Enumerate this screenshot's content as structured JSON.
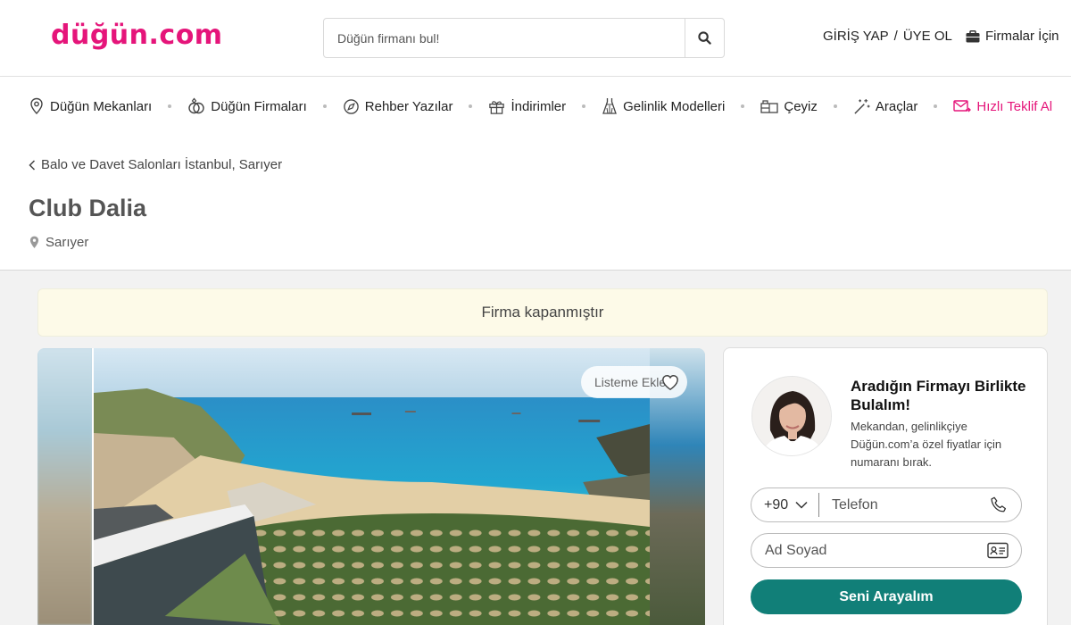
{
  "brand": {
    "logo_text": "düğün.com",
    "accent": "#e5157a",
    "cta_color": "#117f78"
  },
  "header": {
    "search_placeholder": "Düğün firmanı bul!",
    "search_icon": "search-icon",
    "login": "GİRİŞ YAP",
    "separator": "/",
    "register": "ÜYE OL",
    "for_business": "Firmalar İçin"
  },
  "nav": {
    "items": [
      {
        "label": "Düğün Mekanları",
        "icon": "location-pin-icon"
      },
      {
        "label": "Düğün Firmaları",
        "icon": "rings-icon"
      },
      {
        "label": "Rehber Yazılar",
        "icon": "compass-icon"
      },
      {
        "label": "İndirimler",
        "icon": "gift-icon"
      },
      {
        "label": "Gelinlik Modelleri",
        "icon": "dress-icon"
      },
      {
        "label": "Çeyiz",
        "icon": "furniture-icon"
      },
      {
        "label": "Araçlar",
        "icon": "magic-wand-icon"
      },
      {
        "label": "Hızlı Teklif Al",
        "icon": "mail-send-icon"
      }
    ]
  },
  "page": {
    "breadcrumb": "Balo ve Davet Salonları İstanbul, Sarıyer",
    "title": "Club Dalia",
    "location": "Sarıyer",
    "notice": "Firma kapanmıştır"
  },
  "gallery": {
    "favorite_label": "Listeme Ekle"
  },
  "lead_form": {
    "title": "Aradığın Firmayı Birlikte Bulalım!",
    "description": "Mekandan, gelinlikçiye Düğün.com’a özel fiyatlar için numaranı bırak.",
    "country_code": "+90",
    "phone_placeholder": "Telefon",
    "name_placeholder": "Ad Soyad",
    "submit": "Seni Arayalım"
  }
}
